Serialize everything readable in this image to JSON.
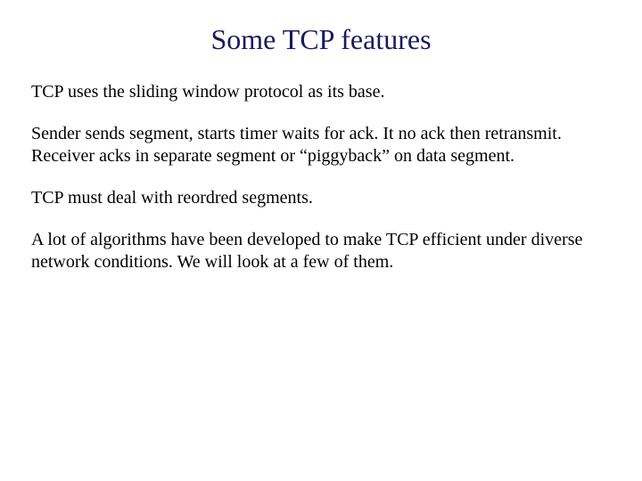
{
  "title": "Some TCP features",
  "paragraphs": [
    "TCP uses the sliding window protocol as its base.",
    "Sender sends segment, starts timer waits for ack. It no ack then retransmit. Receiver acks in separate segment or “piggyback” on data segment.",
    "TCP must deal with reordred segments.",
    "A lot of algorithms have been developed to make TCP efficient under diverse network conditions. We will look at a few of them."
  ]
}
